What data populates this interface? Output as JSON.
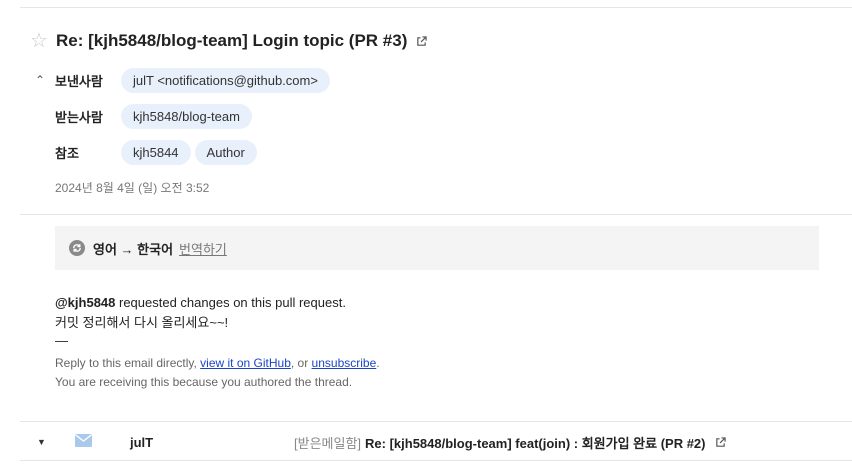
{
  "email": {
    "subject": "Re: [kjh5848/blog-team] Login topic (PR #3)",
    "from_label": "보낸사람",
    "from": "julT <notifications@github.com>",
    "to_label": "받는사람",
    "to": "kjh5848/blog-team",
    "cc_label": "참조",
    "cc": [
      "kjh5844",
      "Author"
    ],
    "date": "2024년 8월 4일 (일) 오전 3:52"
  },
  "translate": {
    "langs": "영어 → 한국어",
    "link": "번역하기"
  },
  "body": {
    "mention": "@kjh5848",
    "line1_rest": " requested changes on this pull request.",
    "line2": "커밋 정리해서 다시 올리세요~~!",
    "dash": "—",
    "footer_prefix": "Reply to this email directly, ",
    "footer_link1": "view it on GitHub",
    "footer_mid": ", or ",
    "footer_link2": "unsubscribe",
    "footer_end": ".",
    "footer_line2": "You are receiving this because you authored the thread."
  },
  "next_mail": {
    "sender": "julT",
    "folder": "[받은메일함]",
    "subject": "Re: [kjh5848/blog-team] feat(join) : 회원가입 완료 (PR #2)"
  },
  "colors": {
    "chip_bg": "#e8f0fb",
    "link": "#1a44c8",
    "translate_bg": "#f4f4f4",
    "mail_icon": "#a8c8ec"
  },
  "icons": {
    "star": "star-outline-icon",
    "external": "external-link-icon",
    "collapse": "chevron-up-icon",
    "translate": "refresh-icon",
    "expand": "caret-down-icon",
    "mail": "envelope-icon"
  }
}
